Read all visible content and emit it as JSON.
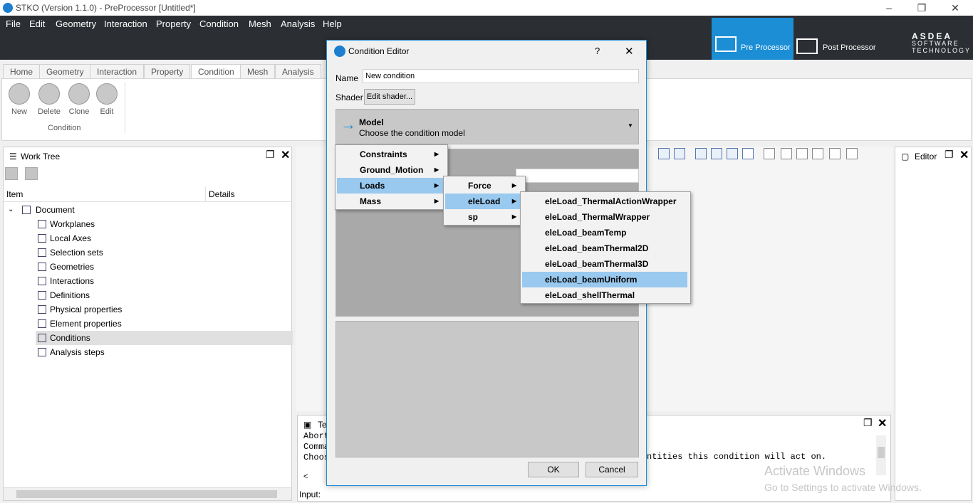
{
  "window": {
    "title": "STKO (Version 1.1.0) - PreProcessor [Untitled*]",
    "controls": [
      "–",
      "❐",
      "✕"
    ]
  },
  "menubar": [
    "File",
    "Edit",
    "Geometry",
    "Interaction",
    "Property",
    "Condition",
    "Mesh",
    "Analysis",
    "Help"
  ],
  "mode_buttons": {
    "pre": "Pre Processor",
    "post": "Post Processor"
  },
  "logo": {
    "name": "ASDEA",
    "tagline1": "SOFTWARE",
    "tagline2": "TECHNOLOGY"
  },
  "ribbon": {
    "tabs": [
      "Home",
      "Geometry",
      "Interaction",
      "Property",
      "Condition",
      "Mesh",
      "Analysis"
    ],
    "active_tab": "Condition",
    "buttons": [
      "New",
      "Delete",
      "Clone",
      "Edit"
    ],
    "group_label": "Condition"
  },
  "work_tree": {
    "title": "Work Tree",
    "columns": [
      "Item",
      "Details"
    ],
    "root": "Document",
    "items": [
      "Workplanes",
      "Local Axes",
      "Selection sets",
      "Geometries",
      "Interactions",
      "Definitions",
      "Physical properties",
      "Element properties",
      "Conditions",
      "Analysis steps"
    ],
    "selected": "Conditions"
  },
  "editor_panel": {
    "title": "Editor"
  },
  "terminal": {
    "title": "Te",
    "lines": [
      "Abort",
      "Comma",
      "Choos"
    ],
    "line_tail": "ntities this condition will act on.",
    "input_label": "Input:"
  },
  "watermark": {
    "line1": "Activate Windows",
    "line2": "Go to Settings to activate Windows."
  },
  "dialog": {
    "title": "Condition Editor",
    "help": "?",
    "close": "✕",
    "name_label": "Name",
    "name_value": "New condition",
    "shader_label": "Shader",
    "shader_button": "Edit shader...",
    "model_title": "Model",
    "model_subtitle": "Choose the condition model",
    "ok": "OK",
    "cancel": "Cancel"
  },
  "menus": {
    "level1": [
      "Constraints",
      "Ground_Motion",
      "Loads",
      "Mass"
    ],
    "level1_selected": "Loads",
    "level2": [
      "Force",
      "eleLoad",
      "sp"
    ],
    "level2_selected": "eleLoad",
    "level3": [
      "eleLoad_ThermalActionWrapper",
      "eleLoad_ThermalWrapper",
      "eleLoad_beamTemp",
      "eleLoad_beamThermal2D",
      "eleLoad_beamThermal3D",
      "eleLoad_beamUniform",
      "eleLoad_shellThermal"
    ],
    "level3_selected": "eleLoad_beamUniform"
  },
  "colors": {
    "accent": "#1b8ed6",
    "menubar": "#2b2f33",
    "highlight": "#99c9ef"
  }
}
